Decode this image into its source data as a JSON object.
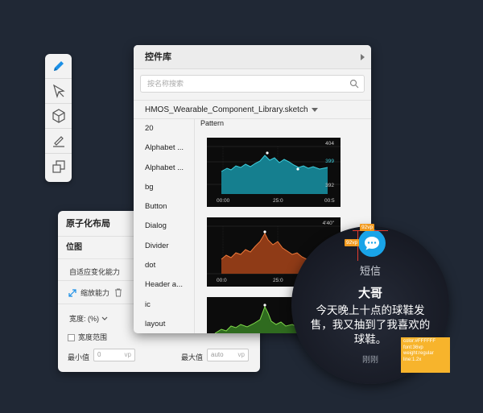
{
  "tools": [
    "pencil-icon",
    "vector-arrow-icon",
    "cube-icon",
    "ruler-icon",
    "export-icon"
  ],
  "colors": {
    "accent": "#1a8fe6",
    "teal": "#1ba6b6",
    "orange": "#e0622a",
    "green": "#4caf50",
    "annotation": "#f29a1f",
    "redline": "#e63c2e"
  },
  "atomic": {
    "title": "原子化布局",
    "section": "位图",
    "adaptive_label": "自适应变化能力",
    "shrink_label": "缩放能力",
    "width_label": "宽度: (%)",
    "width_range_label": "宽度范围",
    "min_label": "最小值",
    "min_value": "0",
    "min_unit": "vp",
    "max_label": "最大值",
    "max_value": "auto",
    "max_unit": "vp"
  },
  "library": {
    "title": "控件库",
    "search_placeholder": "按名称搜索",
    "library_name": "HMOS_Wearable_Component_Library.sketch",
    "pattern_label": "Pattern",
    "items": [
      "20",
      "Alphabet ...",
      "Alphabet ...",
      "bg",
      "Button",
      "Dialog",
      "Divider",
      "dot",
      "Header a...",
      "ic",
      "layout"
    ],
    "thumbs": [
      {
        "top_value": "404",
        "mid_value": "399",
        "bottom_value": "392",
        "x_labels": [
          "00:00",
          "25:0",
          "00:5"
        ]
      },
      {
        "top_value": "4'40\"",
        "x_labels": [
          "00:0",
          "25:0"
        ]
      },
      {}
    ]
  },
  "watch": {
    "app_name": "短信",
    "sender": "大哥",
    "message": "今天晚上十点的球鞋发售，我又抽到了我喜欢的球鞋。",
    "time": "刚刚"
  },
  "annotations": {
    "tag_top": "92vp",
    "tag_left": "92vp",
    "spec_lines": [
      "color:#FFFFFF",
      "font:36vp",
      "weight:regular",
      "line:1.2x"
    ]
  }
}
